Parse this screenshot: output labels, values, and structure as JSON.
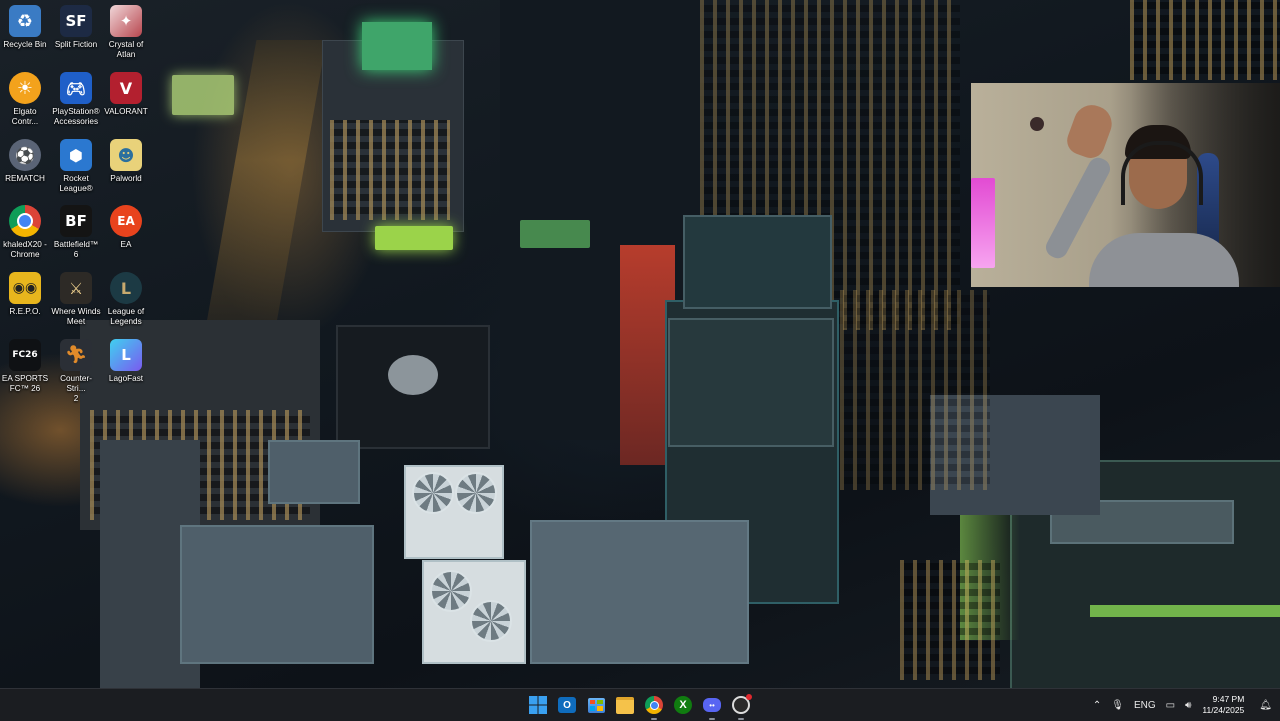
{
  "desktop": {
    "icons": [
      {
        "label": "Recycle Bin",
        "icon": "recycle-bin-icon",
        "color": "#2f6fb0"
      },
      {
        "label": "Split Fiction",
        "icon": "split-fiction-icon",
        "color": "#1d2a44",
        "glyph": "SF"
      },
      {
        "label": "Crystal of\nAtlan",
        "icon": "crystal-of-atlan-icon",
        "color": "#b8474f"
      },
      {
        "label": "Elgato\nContr...",
        "icon": "elgato-icon",
        "color": "#f3a21c"
      },
      {
        "label": "PlayStation®\nAccessories",
        "icon": "playstation-icon",
        "color": "#1f5fc8"
      },
      {
        "label": "VALORANT",
        "icon": "valorant-icon",
        "color": "#b3202f"
      },
      {
        "label": "REMATCH",
        "icon": "rematch-icon",
        "color": "#4b5566"
      },
      {
        "label": "Rocket\nLeague®",
        "icon": "rocket-league-icon",
        "color": "#2b78d0"
      },
      {
        "label": "Palworld",
        "icon": "palworld-icon",
        "color": "#4fa7d8"
      },
      {
        "label": "khaledX20 -\nChrome",
        "icon": "chrome-icon",
        "color": "#dfe3e8"
      },
      {
        "label": "Battlefield™ 6",
        "icon": "battlefield-icon",
        "color": "#141414",
        "glyph": "BF"
      },
      {
        "label": "EA",
        "icon": "ea-icon",
        "color": "#e8431d",
        "glyph": "EA"
      },
      {
        "label": "R.E.P.O.",
        "icon": "repo-icon",
        "color": "#e8b61d"
      },
      {
        "label": "Where Winds\nMeet",
        "icon": "where-winds-meet-icon",
        "color": "#2d2a26"
      },
      {
        "label": "League of\nLegends",
        "icon": "league-of-legends-icon",
        "color": "#1c3a44"
      },
      {
        "label": "EA SPORTS\nFC™ 26",
        "icon": "ea-sports-fc-icon",
        "color": "#0f1114"
      },
      {
        "label": "Counter-Stri...\n2",
        "icon": "counter-strike-icon",
        "color": "#e08a2a"
      },
      {
        "label": "LagoFast",
        "icon": "lagofast-icon",
        "color": "#5d6fe8"
      }
    ]
  },
  "taskbar": {
    "apps": [
      {
        "name": "start-button",
        "icon": "windows-icon"
      },
      {
        "name": "outlook-button",
        "icon": "outlook-icon"
      },
      {
        "name": "store-button",
        "icon": "store-icon"
      },
      {
        "name": "file-explorer-button",
        "icon": "folder-icon"
      },
      {
        "name": "chrome-button",
        "icon": "chrome-icon"
      },
      {
        "name": "xbox-button",
        "icon": "xbox-icon"
      },
      {
        "name": "discord-button",
        "icon": "discord-icon"
      },
      {
        "name": "obs-button",
        "icon": "obs-icon"
      }
    ],
    "tray": {
      "language": "ENG",
      "time": "9:47 PM",
      "date": "11/24/2025"
    }
  }
}
